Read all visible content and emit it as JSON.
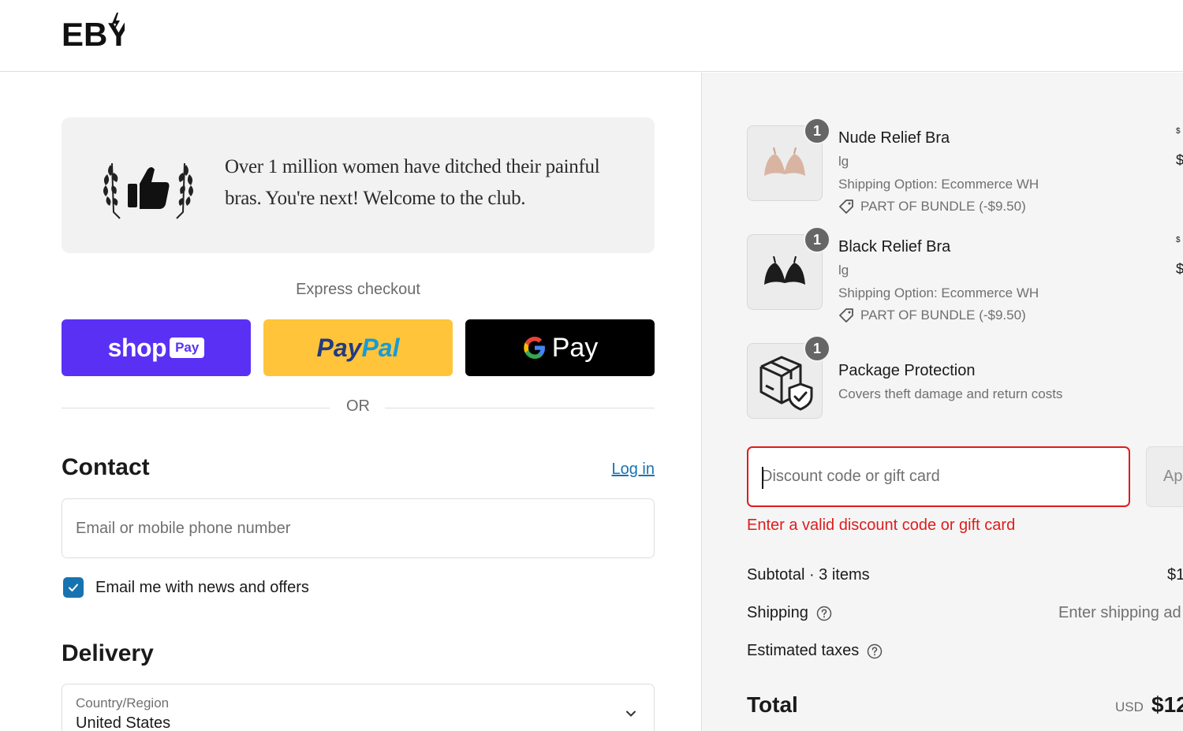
{
  "header": {
    "logo_text": "EBY"
  },
  "banner": {
    "text": "Over 1 million women have ditched their painful bras. You're next! Welcome to the club.",
    "icon": "thumbs-up-laurel-icon"
  },
  "express": {
    "label": "Express checkout",
    "shop_pay": {
      "brand": "shop",
      "badge": "Pay"
    },
    "paypal": {
      "label_a": "Pay",
      "label_b": "Pal"
    },
    "gpay": {
      "label": "Pay"
    },
    "or_label": "OR"
  },
  "contact": {
    "title": "Contact",
    "login_label": "Log in",
    "email_placeholder": "Email or mobile phone number",
    "newsletter_label": "Email me with news and offers",
    "newsletter_checked": true
  },
  "delivery": {
    "title": "Delivery",
    "country_label": "Country/Region",
    "country_value": "United States"
  },
  "cart": {
    "items": [
      {
        "quantity": "1",
        "name": "Nude Relief Bra",
        "variant": "lg",
        "shipping_option": "Shipping Option: Ecommerce WH",
        "bundle": "PART OF BUNDLE (-$9.50)",
        "price_top": "$",
        "price_bottom": "$"
      },
      {
        "quantity": "1",
        "name": "Black Relief Bra",
        "variant": "lg",
        "shipping_option": "Shipping Option: Ecommerce WH",
        "bundle": "PART OF BUNDLE (-$9.50)",
        "price_top": "$",
        "price_bottom": "$"
      },
      {
        "quantity": "1",
        "name": "Package Protection",
        "description": "Covers theft damage and return costs"
      }
    ]
  },
  "discount": {
    "placeholder": "Discount code or gift card",
    "apply_label": "Ap",
    "error": "Enter a valid discount code or gift card"
  },
  "summary": {
    "subtotal_label": "Subtotal · 3 items",
    "subtotal_value": "$1",
    "shipping_label": "Shipping",
    "shipping_value": "Enter shipping ad",
    "taxes_label": "Estimated taxes",
    "total_label": "Total",
    "total_currency": "USD",
    "total_value": "$12"
  },
  "colors": {
    "shop_pay": "#5a31f4",
    "paypal": "#ffc439",
    "gpay": "#000000",
    "link": "#1773b0",
    "error": "#dd1d1d",
    "sidebar_bg": "#f5f5f5"
  }
}
